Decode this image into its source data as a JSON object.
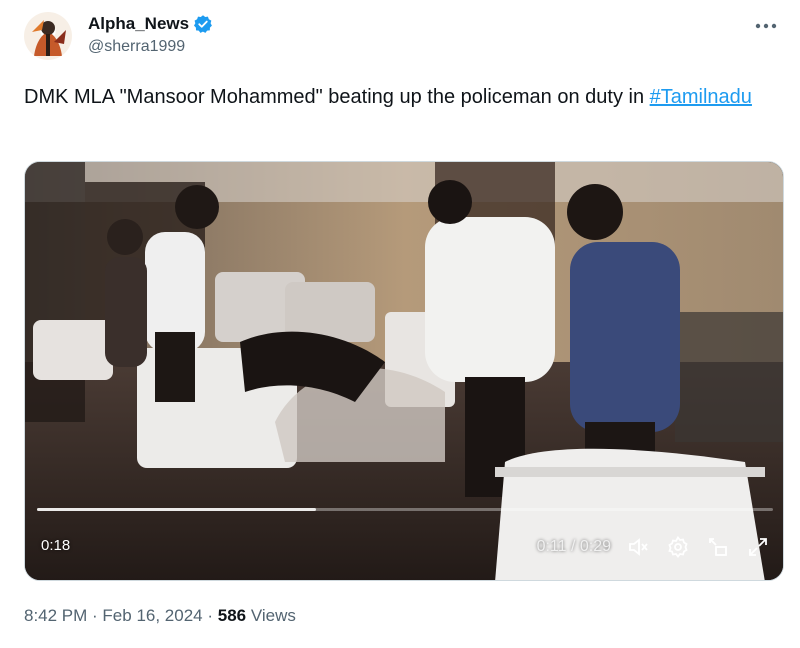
{
  "account": {
    "display_name": "Alpha_News",
    "handle": "@sherra1999",
    "verified": true
  },
  "tweet": {
    "text": "DMK MLA \"Mansoor Mohammed\" beating up the policeman on duty in ",
    "hashtag": "#Tamilnadu"
  },
  "video": {
    "badge_time": "0:18",
    "current_time": "0:11",
    "separator": " / ",
    "duration": "0:29",
    "progress_fraction": 0.379
  },
  "meta": {
    "time": "8:42 PM",
    "dot1": " · ",
    "date": "Feb 16, 2024",
    "dot2": " · ",
    "views_count": "586",
    "views_label": " Views"
  },
  "icons": {
    "verified": "verified-badge-icon",
    "more": "more-options-icon",
    "mute": "mute-icon",
    "settings": "settings-gear-icon",
    "pip": "picture-in-picture-icon",
    "fullscreen": "fullscreen-icon"
  },
  "colors": {
    "link": "#1d9bf0",
    "secondary_text": "#536471",
    "primary_text": "#0f1419"
  }
}
